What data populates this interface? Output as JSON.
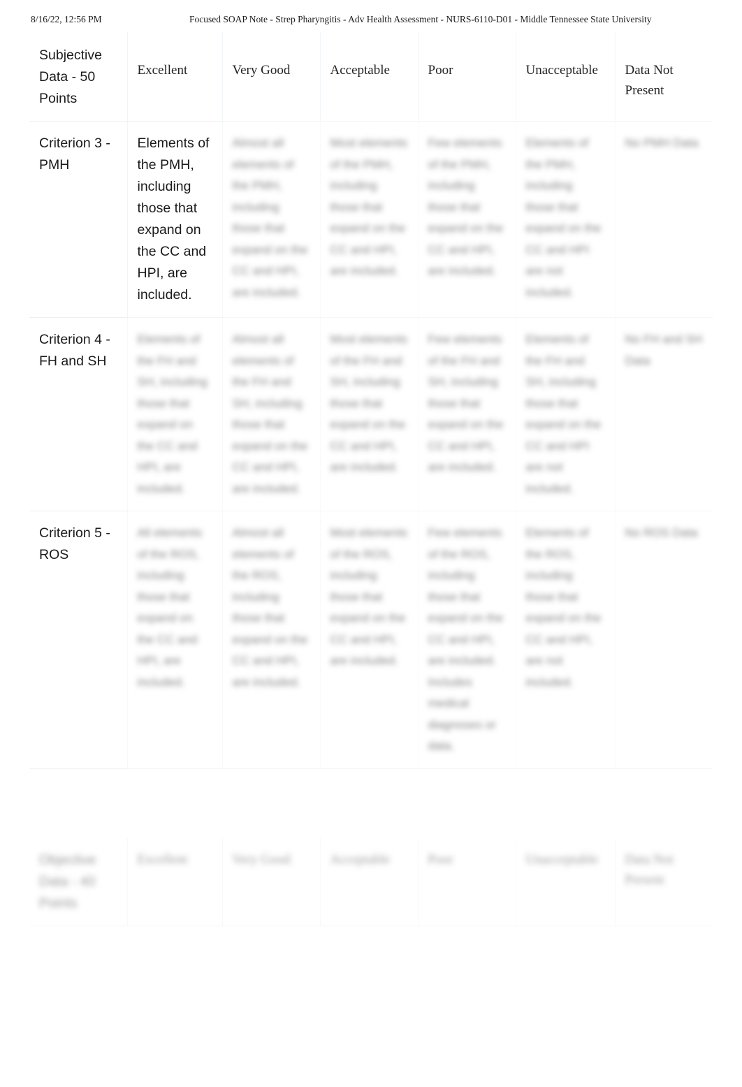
{
  "print_header": {
    "date": "8/16/22, 12:56 PM",
    "title": "Focused SOAP Note - Strep Pharyngitis - Adv Health Assessment - NURS-6110-D01 - Middle Tennessee State University"
  },
  "table_subjective": {
    "headers": {
      "criterion": "Subjective Data - 50 Points",
      "levels": [
        "Excellent",
        "Very Good",
        "Acceptable",
        "Poor",
        "Unacceptable",
        "Data Not Present"
      ]
    },
    "rows": [
      {
        "criterion": "Criterion 3 - PMH",
        "cells": [
          "Elements of the PMH, including those that expand on the CC and HPI, are included.",
          "Almost all elements of the PMH, including those that expand on the CC and HPI, are included.",
          "Most elements of the PMH, including those that expand on the CC and HPI, are included.",
          "Few elements of the PMH, including those that expand on the CC and HPI, are included.",
          "Elements of the PMH, including those that expand on the CC and HPI are not included.",
          "No PMH Data"
        ]
      },
      {
        "criterion": "Criterion 4 - FH and SH",
        "cells": [
          "Elements of the FH and SH, including those that expand on the CC and HPI, are included.",
          "Almost all elements of the FH and SH, including those that expand on the CC and HPI, are included.",
          "Most elements of the FH and SH, including those that expand on the CC and HPI, are included.",
          "Few elements of the FH and SH, including those that expand on the CC and HPI, are included.",
          "Elements of the FH and SH, including those that expand on the CC and HPI are not included.",
          "No FH and SH Data"
        ]
      },
      {
        "criterion": "Criterion 5 - ROS",
        "cells": [
          "All elements of the ROS, including those that expand on the CC and HPI, are included.",
          "Almost all elements of the ROS, including those that expand on the CC and HPI, are included.",
          "Most elements of the ROS, including those that expand on the CC and HPI, are included.",
          "Few elements of the ROS, including those that expand on the CC and HPI, are included. Includes medical diagnoses or data.",
          "Elements of the ROS, including those that expand on the CC and HPI, are not included.",
          "No ROS Data"
        ]
      }
    ]
  },
  "table_objective": {
    "headers": {
      "criterion": "Objective Data - 40 Points",
      "levels": [
        "Excellent",
        "Very Good",
        "Acceptable",
        "Poor",
        "Unacceptable",
        "Data Not Present"
      ]
    }
  }
}
